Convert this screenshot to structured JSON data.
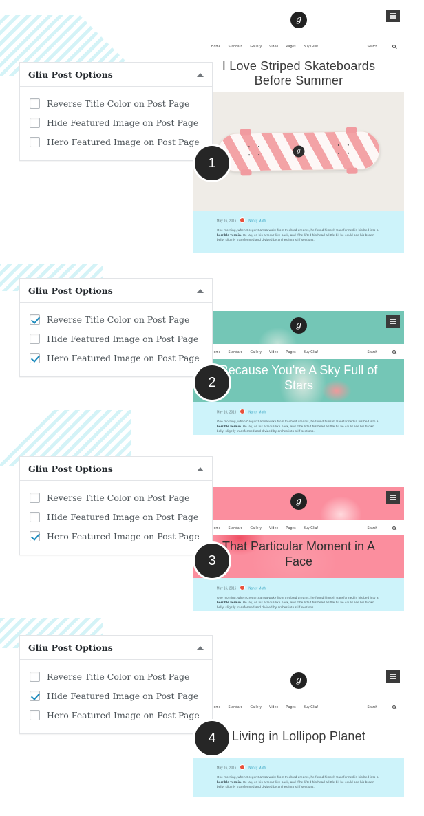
{
  "panel": {
    "title": "Gliu Post Options",
    "collapse_icon": "chevron-up-icon",
    "options": [
      "Reverse Title Color on Post Page",
      "Hide Featured Image on Post Page",
      "Hero Featured Image on Post Page"
    ]
  },
  "colors": {
    "accent_check": "#1e8cbe",
    "badge": "#262626",
    "content_band": "#cdf3fa",
    "stripe": "#d4f3f7",
    "hero_teal": "#74c6b6",
    "hero_pink": "#fb8e9e",
    "featured_bg": "#efece7"
  },
  "site": {
    "logo": "gliu-monogram-logo",
    "menu_icon": "hamburger-menu-icon",
    "search_icon": "search-icon",
    "search_label": "Search",
    "nav": [
      "Home",
      "Standard",
      "Gallery",
      "Video",
      "Pages",
      "Buy Gliu!"
    ],
    "meta": {
      "date": "May 16, 2016",
      "author": "Nancy Math",
      "avatar": "author-avatar"
    },
    "excerpt_pre": "One morning, when Gregor Samsa woke from troubled dreams, he found himself transformed in his bed into a ",
    "excerpt_bold": "horrible vermin",
    "excerpt_post": ". He lay, on his armour-like back, and if he lifted his head a little bit he could see his brown belly, slightly transformed and divided by arches into stiff sections."
  },
  "steps": [
    {
      "number": "1",
      "post_title": "I Love Striped Skateboards Before Summer",
      "checked": [
        false,
        false,
        false
      ],
      "featured": "striped-skateboard-photo"
    },
    {
      "number": "2",
      "post_title": "Because You're A Sky Full of Stars",
      "checked": [
        true,
        false,
        true
      ],
      "featured": "teal-portrait-hero-photo"
    },
    {
      "number": "3",
      "post_title": "That Particular Moment in A Face",
      "checked": [
        false,
        false,
        true
      ],
      "featured": "pink-painted-face-hero-photo"
    },
    {
      "number": "4",
      "post_title": "Living in Lollipop Planet",
      "checked": [
        false,
        true,
        false
      ],
      "featured": "none"
    }
  ]
}
